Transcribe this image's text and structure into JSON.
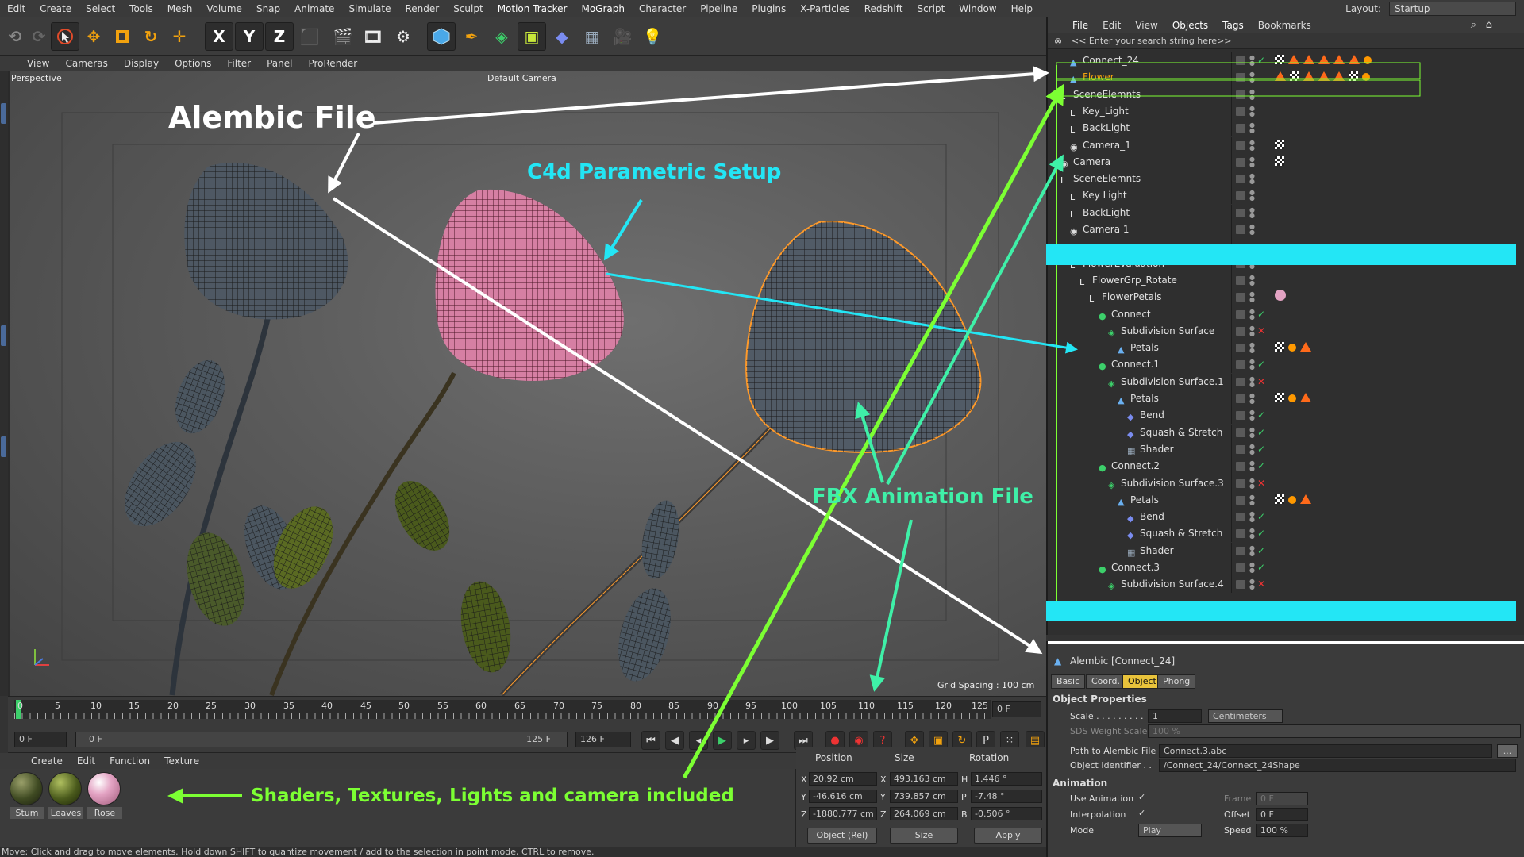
{
  "menubar": {
    "items": [
      "Edit",
      "Create",
      "Select",
      "Tools",
      "Mesh",
      "Volume",
      "Snap",
      "Animate",
      "Simulate",
      "Render",
      "Sculpt",
      "Motion Tracker",
      "MoGraph",
      "Character",
      "Pipeline",
      "Plugins",
      "X-Particles",
      "Redshift",
      "Script",
      "Window",
      "Help"
    ],
    "layout_label": "Layout:",
    "layout_value": "Startup"
  },
  "toolbar": {
    "axis_x": "X",
    "axis_y": "Y",
    "axis_z": "Z"
  },
  "viewport": {
    "menu": [
      "View",
      "Cameras",
      "Display",
      "Options",
      "Filter",
      "Panel",
      "ProRender"
    ],
    "projection": "Perspective",
    "camera": "Default Camera",
    "grid_spacing": "Grid Spacing : 100 cm"
  },
  "annotations": {
    "alembic": "Alembic File",
    "parametric": "C4d Parametric Setup",
    "fbx": "FBX Animation File",
    "shaders": "Shaders, Textures, Lights and camera included"
  },
  "timeline": {
    "ticks": [
      "0",
      "5",
      "10",
      "15",
      "20",
      "25",
      "30",
      "35",
      "40",
      "45",
      "50",
      "55",
      "60",
      "65",
      "70",
      "75",
      "80",
      "85",
      "90",
      "95",
      "100",
      "105",
      "110",
      "115",
      "120",
      "125"
    ],
    "current_frame": "0 F",
    "start_field": "0 F",
    "range_start": "0 F",
    "range_end": "125 F",
    "end_field": "126 F"
  },
  "material": {
    "menu": [
      "Create",
      "Edit",
      "Function",
      "Texture"
    ],
    "materials": [
      {
        "name": "Stum",
        "color": "#3f4a22"
      },
      {
        "name": "Leaves",
        "color": "#4a5a1c"
      },
      {
        "name": "Rose",
        "color": "#e3a3c3"
      }
    ]
  },
  "coords": {
    "headers": [
      "Position",
      "Size",
      "Rotation"
    ],
    "rows": [
      {
        "axis": "X",
        "pos": "20.92 cm",
        "size_axis": "X",
        "size": "493.163 cm",
        "rot_axis": "H",
        "rot": "1.446 °"
      },
      {
        "axis": "Y",
        "pos": "-46.616 cm",
        "size_axis": "Y",
        "size": "739.857 cm",
        "rot_axis": "P",
        "rot": "-7.48 °"
      },
      {
        "axis": "Z",
        "pos": "-1880.777 cm",
        "size_axis": "Z",
        "size": "264.069 cm",
        "rot_axis": "B",
        "rot": "-0.506 °"
      }
    ],
    "mode": "Object (Rel)",
    "size_mode": "Size",
    "apply": "Apply"
  },
  "status": "Move: Click and drag to move elements. Hold down SHIFT to quantize movement / add to the selection in point mode, CTRL to remove.",
  "object_manager": {
    "menu": [
      "File",
      "Edit",
      "View",
      "Objects",
      "Tags",
      "Bookmarks"
    ],
    "search_placeholder": "<< Enter your search string here>>",
    "rows": [
      {
        "name": "Connect_24",
        "indent": 1,
        "icon": "alembic",
        "check": "✓",
        "tags": "alembic"
      },
      {
        "name": "Flower",
        "indent": 1,
        "icon": "alembic",
        "check": "",
        "tags": "fbx"
      },
      {
        "name": "SceneElemnts",
        "indent": 0,
        "icon": "null",
        "check": "",
        "tags": ""
      },
      {
        "name": "Key_Light",
        "indent": 1,
        "icon": "null",
        "check": "",
        "tags": ""
      },
      {
        "name": "BackLight",
        "indent": 1,
        "icon": "null",
        "check": "",
        "tags": ""
      },
      {
        "name": "Camera_1",
        "indent": 1,
        "icon": "camera",
        "check": "",
        "tags": "cam"
      },
      {
        "name": "Camera",
        "indent": 0,
        "icon": "camera",
        "check": "",
        "tags": "cam"
      },
      {
        "name": "SceneElemnts",
        "indent": 0,
        "icon": "null",
        "check": "",
        "tags": ""
      },
      {
        "name": "Key Light",
        "indent": 1,
        "icon": "null",
        "check": "",
        "tags": ""
      },
      {
        "name": "BackLight",
        "indent": 1,
        "icon": "null",
        "check": "",
        "tags": ""
      },
      {
        "name": "Camera 1",
        "indent": 1,
        "icon": "camera",
        "check": "",
        "tags": ""
      },
      {
        "name": "",
        "indent": 0,
        "icon": "",
        "check": "",
        "tags": ""
      },
      {
        "name": "FlowerEvaluation",
        "indent": 1,
        "icon": "null",
        "check": "",
        "tags": ""
      },
      {
        "name": "FlowerGrp_Rotate",
        "indent": 2,
        "icon": "null",
        "check": "",
        "tags": ""
      },
      {
        "name": "FlowerPetals",
        "indent": 3,
        "icon": "null",
        "check": "",
        "tags": "mat"
      },
      {
        "name": "Connect",
        "indent": 4,
        "icon": "connect",
        "check": "✓",
        "tags": ""
      },
      {
        "name": "Subdivision Surface",
        "indent": 5,
        "icon": "subd",
        "check": "✕",
        "tags": ""
      },
      {
        "name": "Petals",
        "indent": 6,
        "icon": "alembic",
        "check": "",
        "tags": "petals"
      },
      {
        "name": "Connect.1",
        "indent": 4,
        "icon": "connect",
        "check": "✓",
        "tags": ""
      },
      {
        "name": "Subdivision Surface.1",
        "indent": 5,
        "icon": "subd",
        "check": "✕",
        "tags": ""
      },
      {
        "name": "Petals",
        "indent": 6,
        "icon": "alembic",
        "check": "",
        "tags": "petals"
      },
      {
        "name": "Bend",
        "indent": 7,
        "icon": "deformer",
        "check": "✓",
        "tags": ""
      },
      {
        "name": "Squash & Stretch",
        "indent": 7,
        "icon": "deformer",
        "check": "✓",
        "tags": ""
      },
      {
        "name": "Shader",
        "indent": 7,
        "icon": "shader",
        "check": "✓",
        "tags": ""
      },
      {
        "name": "Connect.2",
        "indent": 4,
        "icon": "connect",
        "check": "✓",
        "tags": ""
      },
      {
        "name": "Subdivision Surface.3",
        "indent": 5,
        "icon": "subd",
        "check": "✕",
        "tags": ""
      },
      {
        "name": "Petals",
        "indent": 6,
        "icon": "alembic",
        "check": "",
        "tags": "petals"
      },
      {
        "name": "Bend",
        "indent": 7,
        "icon": "deformer",
        "check": "✓",
        "tags": ""
      },
      {
        "name": "Squash & Stretch",
        "indent": 7,
        "icon": "deformer",
        "check": "✓",
        "tags": ""
      },
      {
        "name": "Shader",
        "indent": 7,
        "icon": "shader",
        "check": "✓",
        "tags": ""
      },
      {
        "name": "Connect.3",
        "indent": 4,
        "icon": "connect",
        "check": "✓",
        "tags": ""
      },
      {
        "name": "Subdivision Surface.4",
        "indent": 5,
        "icon": "subd",
        "check": "✕",
        "tags": ""
      }
    ]
  },
  "attributes": {
    "title": "Alembic [Connect_24]",
    "tabs": [
      "Basic",
      "Coord.",
      "Object",
      "Phong"
    ],
    "active_tab": "Object",
    "section_object": "Object Properties",
    "scale_label": "Scale . . . . . . . . .",
    "scale_value": "1",
    "scale_unit": "Centimeters",
    "sds_label": "SDS Weight Scale",
    "sds_value": "100 %",
    "path_label": "Path to Alembic File",
    "path_value": "Connect.3.abc",
    "path_button": "...",
    "ident_label": "Object Identifier . .",
    "ident_value": "/Connect_24/Connect_24Shape",
    "section_anim": "Animation",
    "use_anim_label": "Use Animation",
    "use_anim_check": "✓",
    "frame_label": "Frame",
    "frame_value": "0 F",
    "interp_label": "Interpolation",
    "interp_check": "✓",
    "offset_label": "Offset",
    "offset_value": "0 F",
    "mode_label": "Mode",
    "mode_value": "Play",
    "speed_label": "Speed",
    "speed_value": "100 %"
  },
  "colors": {
    "cyan": "#23e6f5",
    "green": "#7cff33",
    "teal": "#3ff0a8",
    "orange": "#ff6a1a",
    "tab_active": "#e9c33b"
  }
}
